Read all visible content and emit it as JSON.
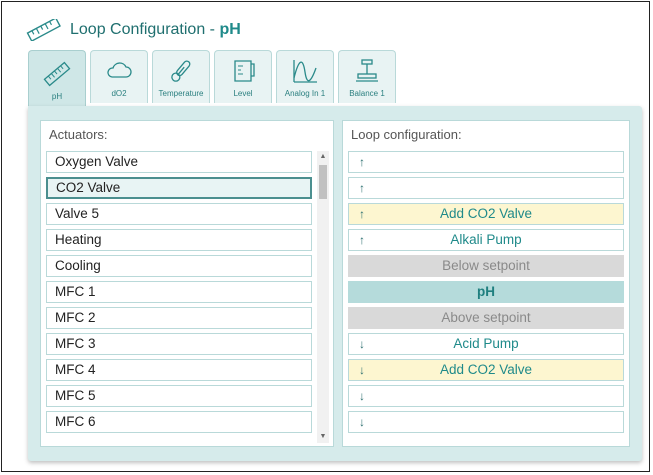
{
  "header": {
    "title_prefix": "Loop Configuration - ",
    "title_loop": "pH"
  },
  "tabs": [
    {
      "label": "pH",
      "icon": "ruler-icon",
      "active": true
    },
    {
      "label": "dO2",
      "icon": "cloud-icon"
    },
    {
      "label": "Temperature",
      "icon": "thermometer-icon"
    },
    {
      "label": "Level",
      "icon": "beaker-icon"
    },
    {
      "label": "Analog In 1",
      "icon": "waveform-icon"
    },
    {
      "label": "Balance 1",
      "icon": "balance-icon"
    }
  ],
  "actuators": {
    "title": "Actuators:",
    "items": [
      "Oxygen Valve",
      "CO2 Valve",
      "Valve 5",
      "Heating",
      "Cooling",
      "MFC 1",
      "MFC 2",
      "MFC 3",
      "MFC 4",
      "MFC 5",
      "MFC 6"
    ],
    "selected": "CO2 Valve"
  },
  "loop": {
    "title": "Loop configuration:",
    "up_arrow": "↑",
    "down_arrow": "↓",
    "above": [
      "",
      "",
      "Add CO2 Valve",
      "Alkali Pump"
    ],
    "below_label": "Below setpoint",
    "center_label": "pH",
    "above_label": "Above setpoint",
    "below": [
      "Acid Pump",
      "Add CO2 Valve",
      "",
      ""
    ]
  },
  "colors": {
    "accent": "#1f8a8a",
    "panel": "#d6ebeb",
    "highlight": "#fdf6d0",
    "separator": "#d9d9d9",
    "center": "#b5dbdb"
  }
}
